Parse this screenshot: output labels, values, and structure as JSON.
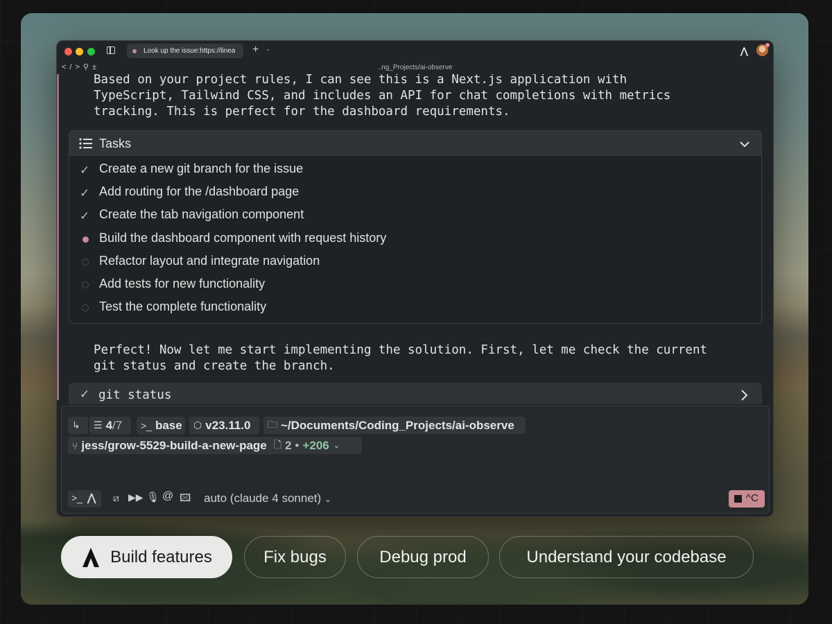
{
  "window": {
    "tab_title": "Look up the issue:https://linea",
    "path": "..ng_Projects/ai-observe"
  },
  "conversation": {
    "intro_text": "Based on your project rules, I can see this is a Next.js application with\nTypeScript, Tailwind CSS, and includes an API for chat completions with metrics\ntracking. This is perfect for the dashboard requirements.",
    "followup_text": "Perfect! Now let me start implementing the solution. First, let me check the current\ngit status and create the branch."
  },
  "tasks": {
    "title": "Tasks",
    "items": [
      {
        "label": "Create a new git branch for the issue",
        "status": "done"
      },
      {
        "label": "Add routing for the /dashboard page",
        "status": "done"
      },
      {
        "label": "Create the tab navigation component",
        "status": "done"
      },
      {
        "label": "Build the dashboard component with request history",
        "status": "in_progress"
      },
      {
        "label": "Refactor layout and integrate navigation",
        "status": "pending"
      },
      {
        "label": "Add tests for new functionality",
        "status": "pending"
      },
      {
        "label": "Test the complete functionality",
        "status": "pending"
      }
    ]
  },
  "command": {
    "text": "git status"
  },
  "context": {
    "progress_current": "4",
    "progress_total": "/7",
    "env": "base",
    "node_version": "v23.11.0",
    "directory": "~/Documents/Coding_Projects/ai-observe",
    "branch": "jess/grow-5529-build-a-new-page",
    "files_changed": "2",
    "separator": "•",
    "additions": "+206"
  },
  "input": {
    "model": "auto (claude 4 sonnet)",
    "stop_label": "^C"
  },
  "pills": [
    {
      "label": "Build features",
      "active": true
    },
    {
      "label": "Fix bugs",
      "active": false
    },
    {
      "label": "Debug prod",
      "active": false
    },
    {
      "label": "Understand your codebase",
      "active": false
    }
  ],
  "colors": {
    "accent": "#c78a9e",
    "window_bg": "#212426",
    "stop_button": "#c98b92",
    "diff_green": "#8fc5a0"
  }
}
